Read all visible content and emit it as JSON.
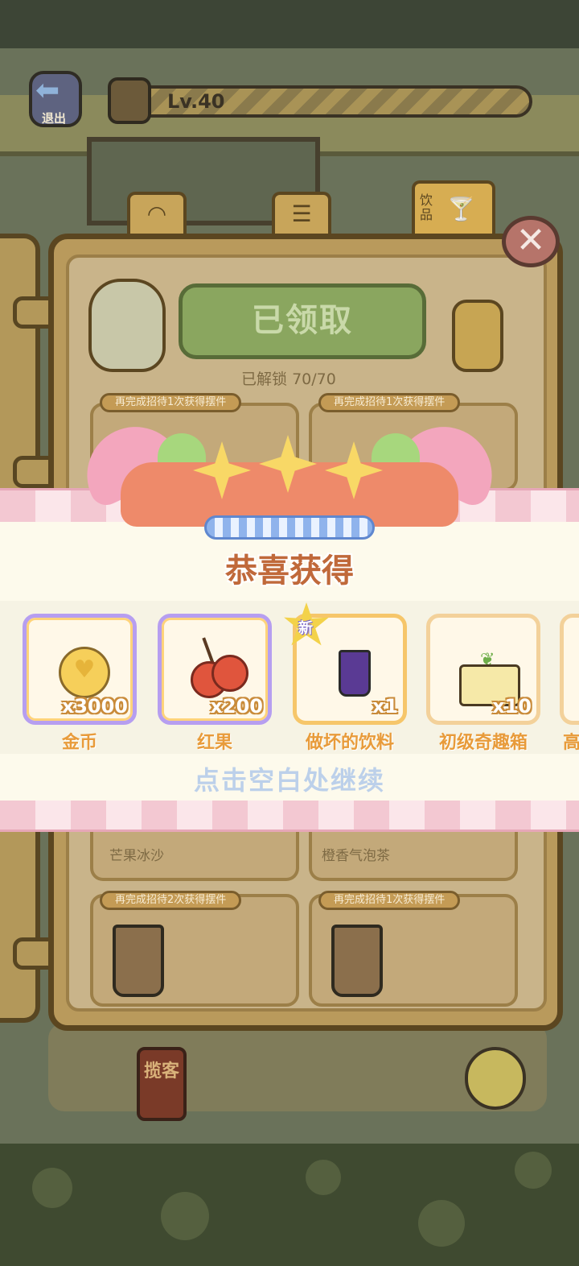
{
  "top_bar": {
    "exit_label": "退出",
    "level_text": "Lv.40"
  },
  "book": {
    "tabs": [
      {
        "icon": "bread-icon"
      },
      {
        "icon": "clipboard-icon"
      },
      {
        "label": "饮品",
        "icon": "drink-icon"
      }
    ],
    "claim_button_label": "已领取",
    "unlock_label": "已解锁",
    "unlock_progress": "70/70",
    "cards": [
      {
        "hint": "再完成招待1次获得摆件",
        "name": ""
      },
      {
        "hint": "再完成招待1次获得摆件",
        "name": ""
      },
      {
        "hint": "",
        "name": "芒果冰沙"
      },
      {
        "hint": "",
        "name": "橙香气泡茶"
      },
      {
        "hint": "再完成招待2次获得摆件",
        "name": ""
      },
      {
        "hint": "再完成招待1次获得摆件",
        "name": ""
      }
    ]
  },
  "reward_popup": {
    "title": "恭喜获得",
    "new_badge": "新",
    "items": [
      {
        "label": "金币",
        "quantity": "x3000",
        "icon": "gold-coin-icon",
        "frame": "rainbow"
      },
      {
        "label": "红果",
        "quantity": "x200",
        "icon": "red-fruit-icon",
        "frame": "rainbow"
      },
      {
        "label": "做坏的饮料",
        "quantity": "x1",
        "icon": "ruined-drink-icon",
        "frame": "gold",
        "is_new": true
      },
      {
        "label": "初级奇趣箱",
        "quantity": "x10",
        "icon": "fun-box-icon",
        "frame": "gold2"
      }
    ],
    "partial_item_label": "高",
    "continue_hint": "点击空白处继续"
  },
  "scene": {
    "shop_sign": "揽客"
  }
}
